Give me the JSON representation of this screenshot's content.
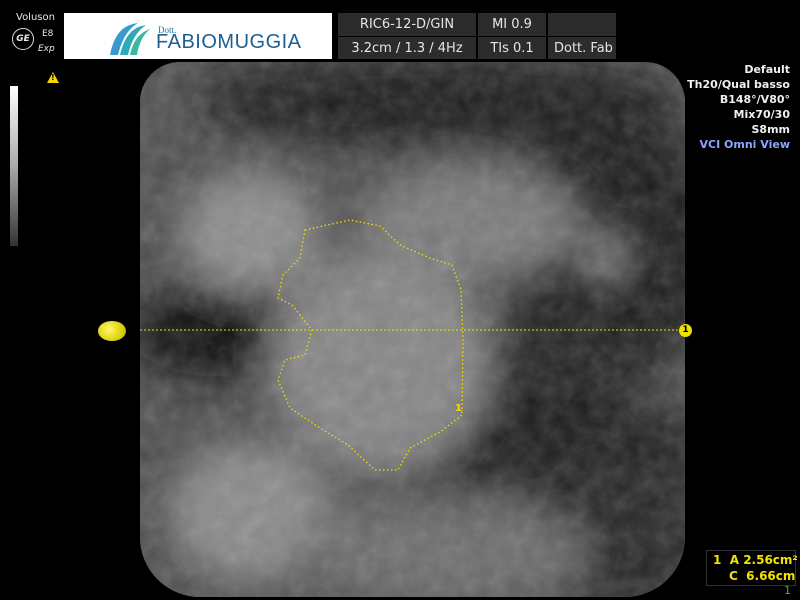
{
  "brand": {
    "vendor": "Voluson",
    "logo_letters": "GE",
    "model": "E8",
    "mode": "Exp"
  },
  "logo": {
    "prefix": "Dott.",
    "name_part1": "FABIO",
    "name_part2": "MUGGIA"
  },
  "header": {
    "probe": "RIC6-12-D/GIN",
    "mi": "MI  0.9",
    "depth": "3.2cm / 1.3 /  4Hz",
    "tis": "TIs  0.1",
    "user": "Dott. Fab"
  },
  "params": [
    "Default",
    "Th20/Qual basso",
    "B148°/V80°",
    "Mix70/30",
    "S8mm"
  ],
  "view_mode": "VCI Omni View",
  "measurement": {
    "index": "1",
    "area_label": "A",
    "area_value": "2.56cm²",
    "circ_label": "C",
    "circ_value": "6.66cm"
  },
  "line_marker": "1",
  "trace_marker": "1",
  "corner_index": "1",
  "colors": {
    "accent_yellow": "#f0e000",
    "header_bg": "#2c2c2c",
    "view_blue": "#8aa4ff"
  }
}
